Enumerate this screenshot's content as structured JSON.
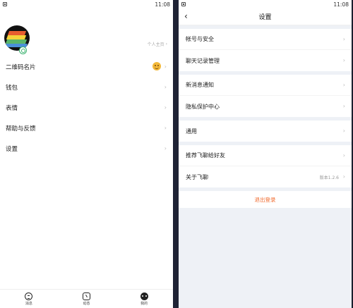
{
  "status": {
    "time_left": "11:08",
    "time_right": "11:08"
  },
  "profile": {
    "homepage_link": "个人主页"
  },
  "left_menu": [
    {
      "label": "二维码名片"
    },
    {
      "label": "钱包"
    },
    {
      "label": "表情"
    },
    {
      "label": "帮助与反馈"
    },
    {
      "label": "设置"
    }
  ],
  "tabs": [
    {
      "label": "消息",
      "icon": "chat-icon"
    },
    {
      "label": "动态",
      "icon": "moments-icon"
    },
    {
      "label": "我的",
      "icon": "me-icon"
    }
  ],
  "settings": {
    "title": "设置",
    "group1": [
      {
        "label": "帐号与安全"
      },
      {
        "label": "聊天记录管理"
      }
    ],
    "group2": [
      {
        "label": "新消息通知"
      },
      {
        "label": "隐私保护中心"
      }
    ],
    "group3": [
      {
        "label": "通用"
      }
    ],
    "group4": [
      {
        "label": "推荐飞聊给好友"
      },
      {
        "label": "关于飞聊",
        "value": "版本1.2.6"
      }
    ],
    "logout": "退出登录"
  },
  "colors": {
    "accent": "#f06b2f",
    "background": "#eef1f6"
  }
}
